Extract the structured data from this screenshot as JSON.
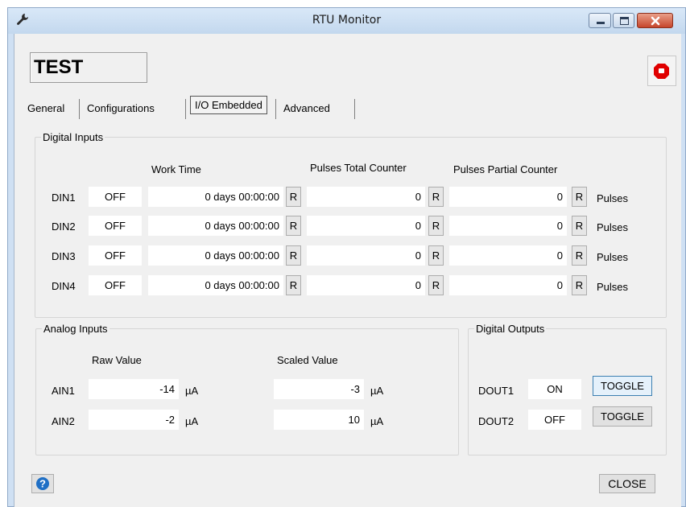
{
  "window": {
    "title": "RTU Monitor",
    "icon": "wrench-icon"
  },
  "device_name": "TEST",
  "tabs": [
    {
      "label": "General"
    },
    {
      "label": "Configurations"
    },
    {
      "label": "I/O Embedded",
      "active": true
    },
    {
      "label": "Advanced"
    }
  ],
  "digital_inputs": {
    "title": "Digital Inputs",
    "headers": {
      "work_time": "Work Time",
      "pulses_total": "Pulses Total Counter",
      "pulses_partial": "Pulses Partial Counter"
    },
    "rows": [
      {
        "name": "DIN1",
        "state": "OFF",
        "work_time": "0 days 00:00:00",
        "work_reset": "R",
        "total": "0",
        "total_reset": "R",
        "partial": "0",
        "partial_reset": "R",
        "unit": "Pulses"
      },
      {
        "name": "DIN2",
        "state": "OFF",
        "work_time": "0 days 00:00:00",
        "work_reset": "R",
        "total": "0",
        "total_reset": "R",
        "partial": "0",
        "partial_reset": "R",
        "unit": "Pulses"
      },
      {
        "name": "DIN3",
        "state": "OFF",
        "work_time": "0 days 00:00:00",
        "work_reset": "R",
        "total": "0",
        "total_reset": "R",
        "partial": "0",
        "partial_reset": "R",
        "unit": "Pulses"
      },
      {
        "name": "DIN4",
        "state": "OFF",
        "work_time": "0 days 00:00:00",
        "work_reset": "R",
        "total": "0",
        "total_reset": "R",
        "partial": "0",
        "partial_reset": "R",
        "unit": "Pulses"
      }
    ]
  },
  "analog_inputs": {
    "title": "Analog Inputs",
    "headers": {
      "raw": "Raw Value",
      "scaled": "Scaled Value"
    },
    "rows": [
      {
        "name": "AIN1",
        "raw": "-14",
        "raw_unit": "µA",
        "scaled": "-3",
        "scaled_unit": "µA"
      },
      {
        "name": "AIN2",
        "raw": "-2",
        "raw_unit": "µA",
        "scaled": "10",
        "scaled_unit": "µA"
      }
    ]
  },
  "digital_outputs": {
    "title": "Digital Outputs",
    "rows": [
      {
        "name": "DOUT1",
        "state": "ON",
        "toggle": "TOGGLE"
      },
      {
        "name": "DOUT2",
        "state": "OFF",
        "toggle": "TOGGLE"
      }
    ]
  },
  "footer": {
    "help_icon": "help-icon",
    "close_label": "CLOSE"
  },
  "colors": {
    "title_bg": "#cfe0f3",
    "close_btn": "#c6452b",
    "stop_icon": "#e00000",
    "help_icon": "#1f6fc5",
    "form_bg": "#f0f0f0"
  }
}
